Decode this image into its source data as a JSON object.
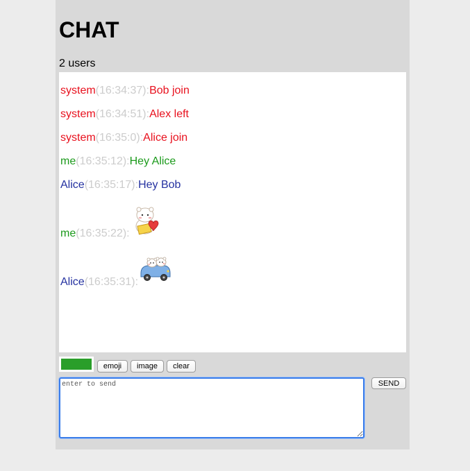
{
  "header": {
    "title": "CHAT",
    "user_count": "2 users"
  },
  "messages": [
    {
      "sender": "system",
      "time": "(16:34:37)",
      "separator": ":",
      "text": "Bob join",
      "color": "#e8101d"
    },
    {
      "sender": "system",
      "time": "(16:34:51)",
      "separator": ":",
      "text": "Alex left",
      "color": "#e8101d"
    },
    {
      "sender": "system",
      "time": "(16:35:0)",
      "separator": ":",
      "text": "Alice join",
      "color": "#e8101d"
    },
    {
      "sender": "me",
      "time": "(16:35:12)",
      "separator": ":",
      "text": "Hey Alice",
      "color": "#1b9a1b"
    },
    {
      "sender": "Alice",
      "time": "(16:35:17)",
      "separator": ":",
      "text": "Hey Bob",
      "color": "#2431a0"
    },
    {
      "sender": "me",
      "time": "(16:35:22)",
      "separator": ":",
      "sticker": "bear-heart-sticker",
      "color": "#1b9a1b"
    },
    {
      "sender": "Alice",
      "time": "(16:35:31)",
      "separator": ":",
      "sticker": "bears-car-sticker",
      "color": "#2431a0"
    }
  ],
  "toolbar": {
    "selected_color": "#2a9e2a",
    "emoji_label": "emoji",
    "image_label": "image",
    "clear_label": "clear"
  },
  "composer": {
    "placeholder": "enter to send",
    "value": "",
    "send_label": "SEND"
  }
}
